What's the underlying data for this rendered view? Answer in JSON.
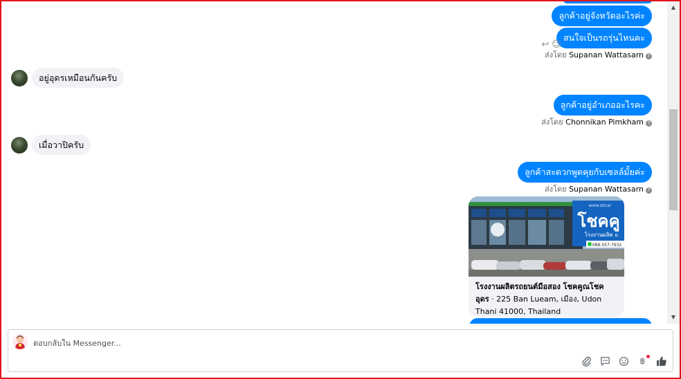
{
  "colors": {
    "outgoing_bubble": "#0084ff",
    "incoming_bubble": "#f0f2f5",
    "frame": "#e0141e"
  },
  "messages": {
    "out_1": "ลูกค้าอยู่จังหวัดอะไรค่ะ",
    "out_2": "สนใจเป็นรถรุ่นไหนคะ",
    "in_1": "อยู่อุดรเหมือนกันครับ",
    "out_3": "ลูกค้าอยู่อำเภออะไรคะ",
    "in_2": "เมื่อวาปิครับ",
    "out_4": "ลูกค้าสะดวกพูดคุยกับเซลล์มั้ยค่ะ"
  },
  "sent_by": {
    "prefix": "ส่งโดย",
    "sender_1": "Supanan Wattasarn",
    "sender_2": "Chonnikan Pimkham",
    "sender_3": "Supanan Wattasarn",
    "help_glyph": "?"
  },
  "card": {
    "image_sign_text": "โชคคู",
    "image_sub_text": "โรงงานผลิต แ",
    "image_phone": "088-557-7932",
    "image_web": "www.okcar",
    "title": "โรงงานผลิตรถยนต์มือสอง โชคคูณโชค อุดร",
    "address": " · 225 Ban Lueam, เมือง, Udon Thani 41000, Thailand"
  },
  "composer": {
    "placeholder": "ตอบกลับใน Messenger..."
  },
  "icons": {
    "reply": "↩",
    "emoji_react": "☺",
    "attach": "paperclip-icon",
    "sticker": "chat-icon",
    "emoji": "smiley-icon",
    "payment": "฿",
    "like": "thumbs-up-icon",
    "scroll_up": "▲",
    "scroll_down": "▼"
  }
}
